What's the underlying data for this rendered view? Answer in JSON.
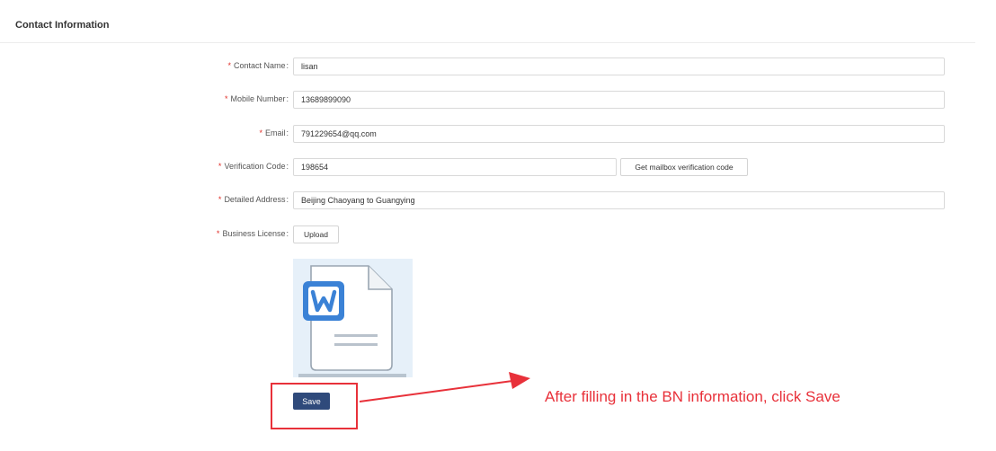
{
  "section": {
    "title": "Contact Information"
  },
  "form": {
    "contact_name": {
      "label": "Contact Name",
      "value": "lisan",
      "required": true
    },
    "mobile_number": {
      "label": "Mobile Number",
      "value": "13689899090",
      "required": true
    },
    "email": {
      "label": "Email",
      "value": "791229654@qq.com",
      "required": true
    },
    "verification_code": {
      "label": "Verification Code",
      "value": "198654",
      "required": true,
      "button_label": "Get mailbox verification code"
    },
    "detailed_address": {
      "label": "Detailed Address",
      "value": "Beijing Chaoyang to Guangying",
      "required": true
    },
    "business_license": {
      "label": "Business License",
      "required": true,
      "upload_label": "Upload",
      "file_icon": "word-document-icon"
    },
    "required_mark": "*",
    "colon": ":"
  },
  "actions": {
    "save_label": "Save"
  },
  "annotation": {
    "text": "After filling in the BN information, click Save",
    "color": "#e8313a"
  },
  "colors": {
    "primary": "#2f4a7b",
    "required": "#e0302a",
    "word_blue": "#3b82d6"
  }
}
